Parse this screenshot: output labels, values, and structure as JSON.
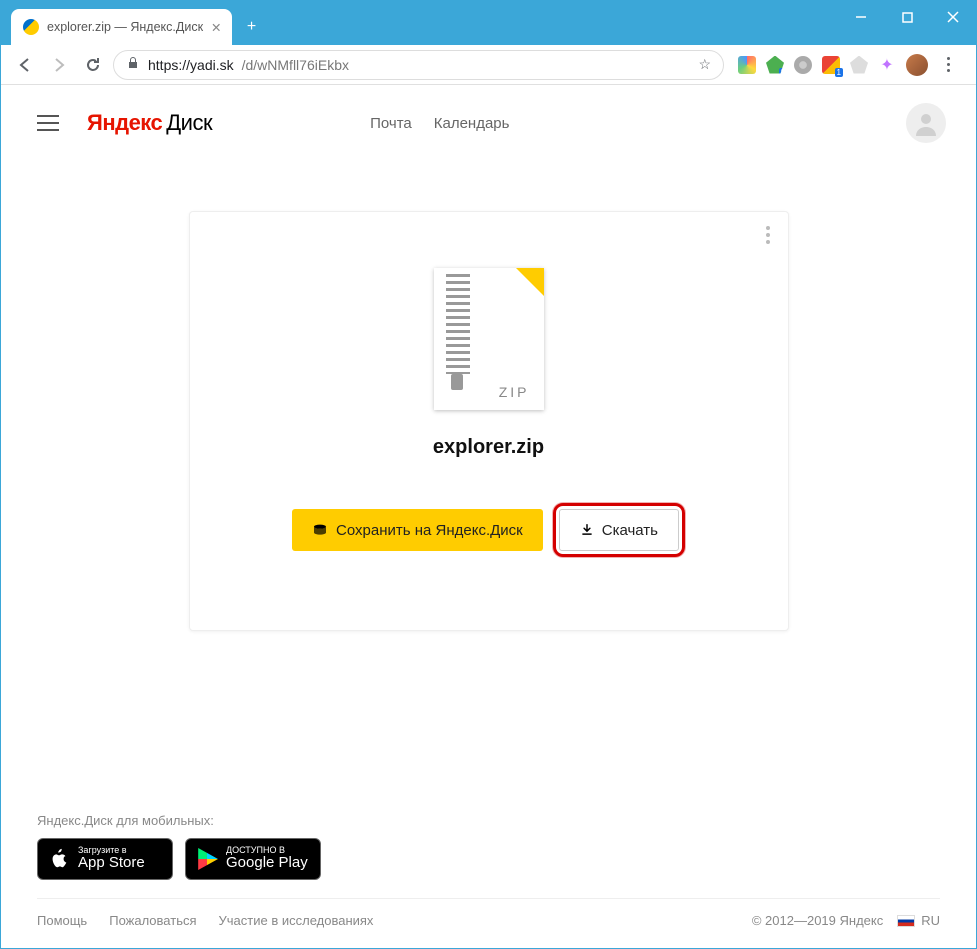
{
  "window": {
    "tab_title": "explorer.zip — Яндекс.Диск"
  },
  "addressbar": {
    "scheme": "https://",
    "host": "yadi.sk",
    "path": "/d/wNMfll76iEkbx"
  },
  "header": {
    "logo_yandex": "Яндекс",
    "logo_disk": "Диск",
    "links": {
      "mail": "Почта",
      "calendar": "Календарь"
    }
  },
  "file": {
    "ext_label": "ZIP",
    "name": "explorer.zip"
  },
  "actions": {
    "save": "Сохранить на Яндекс.Диск",
    "download": "Скачать"
  },
  "mobile": {
    "label": "Яндекс.Диск для мобильных:",
    "appstore_small": "Загрузите в",
    "appstore_big": "App Store",
    "play_small": "ДОСТУПНО В",
    "play_big": "Google Play"
  },
  "footer": {
    "help": "Помощь",
    "abuse": "Пожаловаться",
    "research": "Участие в исследованиях",
    "copyright": "© 2012—2019  Яндекс",
    "lang": "RU"
  }
}
